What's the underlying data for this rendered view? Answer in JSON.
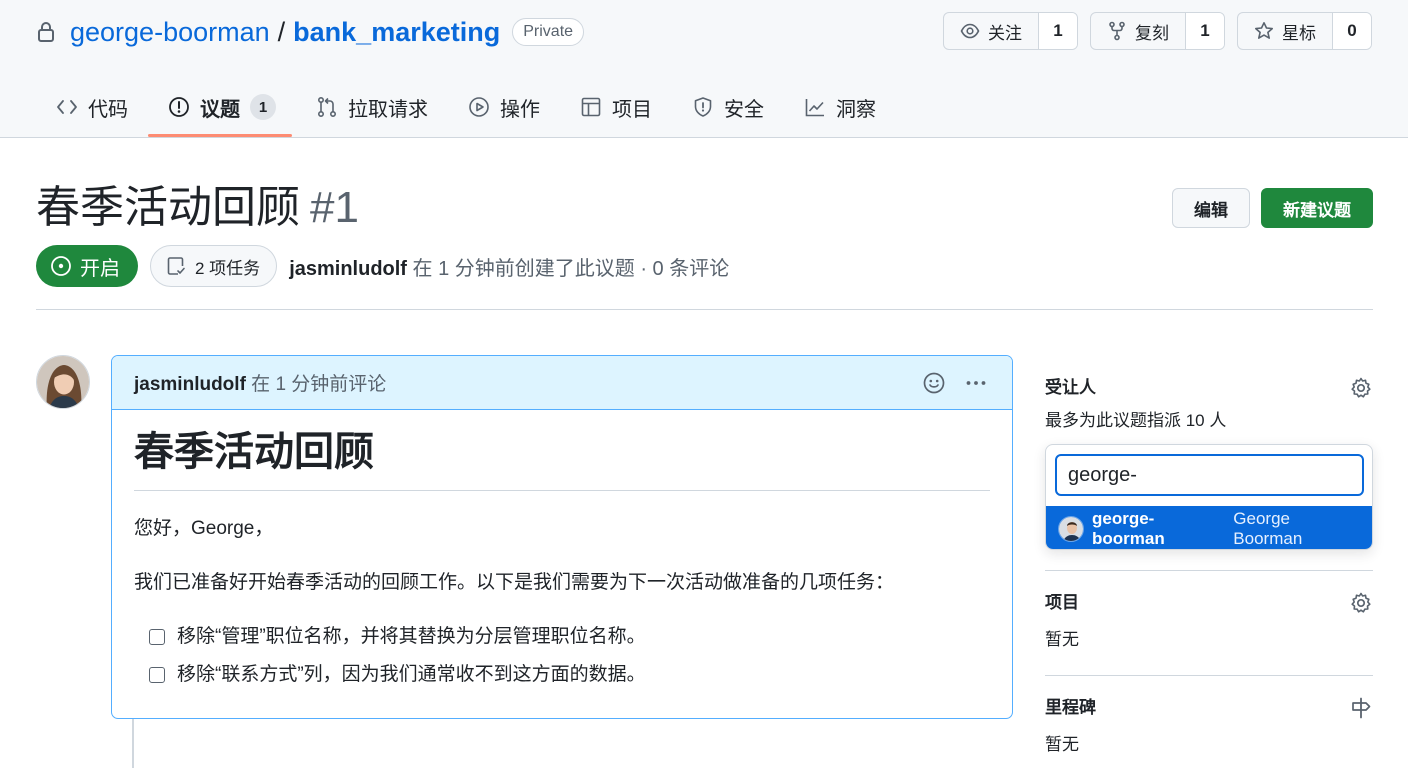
{
  "repo": {
    "owner": "george-boorman",
    "separator": "/",
    "name": "bank_marketing",
    "visibility": "Private"
  },
  "repo_actions": [
    {
      "label": "关注",
      "count": "1",
      "icon": "eye-icon"
    },
    {
      "label": "复刻",
      "count": "1",
      "icon": "fork-icon"
    },
    {
      "label": "星标",
      "count": "0",
      "icon": "star-icon"
    }
  ],
  "nav": {
    "code": "代码",
    "issues": "议题",
    "issues_count": "1",
    "pulls": "拉取请求",
    "actions": "操作",
    "projects": "项目",
    "security": "安全",
    "insights": "洞察"
  },
  "issue": {
    "title": "春季活动回顾",
    "number": "#1",
    "state": "开启",
    "tasks": "2 项任务",
    "author": "jasminludolf",
    "meta_suffix": " 在 1 分钟前创建了此议题 · 0 条评论",
    "edit_label": "编辑",
    "new_issue_label": "新建议题"
  },
  "comment": {
    "author": "jasminludolf",
    "time": " 在 1 分钟前评论",
    "heading": "春季活动回顾",
    "greeting": "您好，George，",
    "intro": "我们已准备好开始春季活动的回顾工作。以下是我们需要为下一次活动做准备的几项任务：",
    "tasks": [
      "移除“管理”职位名称，并将其替换为分层管理职位名称。",
      "移除“联系方式”列，因为我们通常收不到这方面的数据。"
    ]
  },
  "sidebar": {
    "assignees_title": "受让人",
    "assignees_note": "最多为此议题指派 10 人",
    "assignee_search_value": "george-",
    "suggestion_login": "george-boorman",
    "suggestion_name": "George Boorman",
    "projects_title": "项目",
    "projects_empty": "暂无",
    "milestone_title": "里程碑",
    "milestone_empty": "暂无"
  },
  "colors": {
    "link": "#0969da",
    "green": "#1f883d",
    "tab_underline": "#fd8c73",
    "comment_header": "#ddf4ff",
    "selected_option": "#0969da"
  }
}
